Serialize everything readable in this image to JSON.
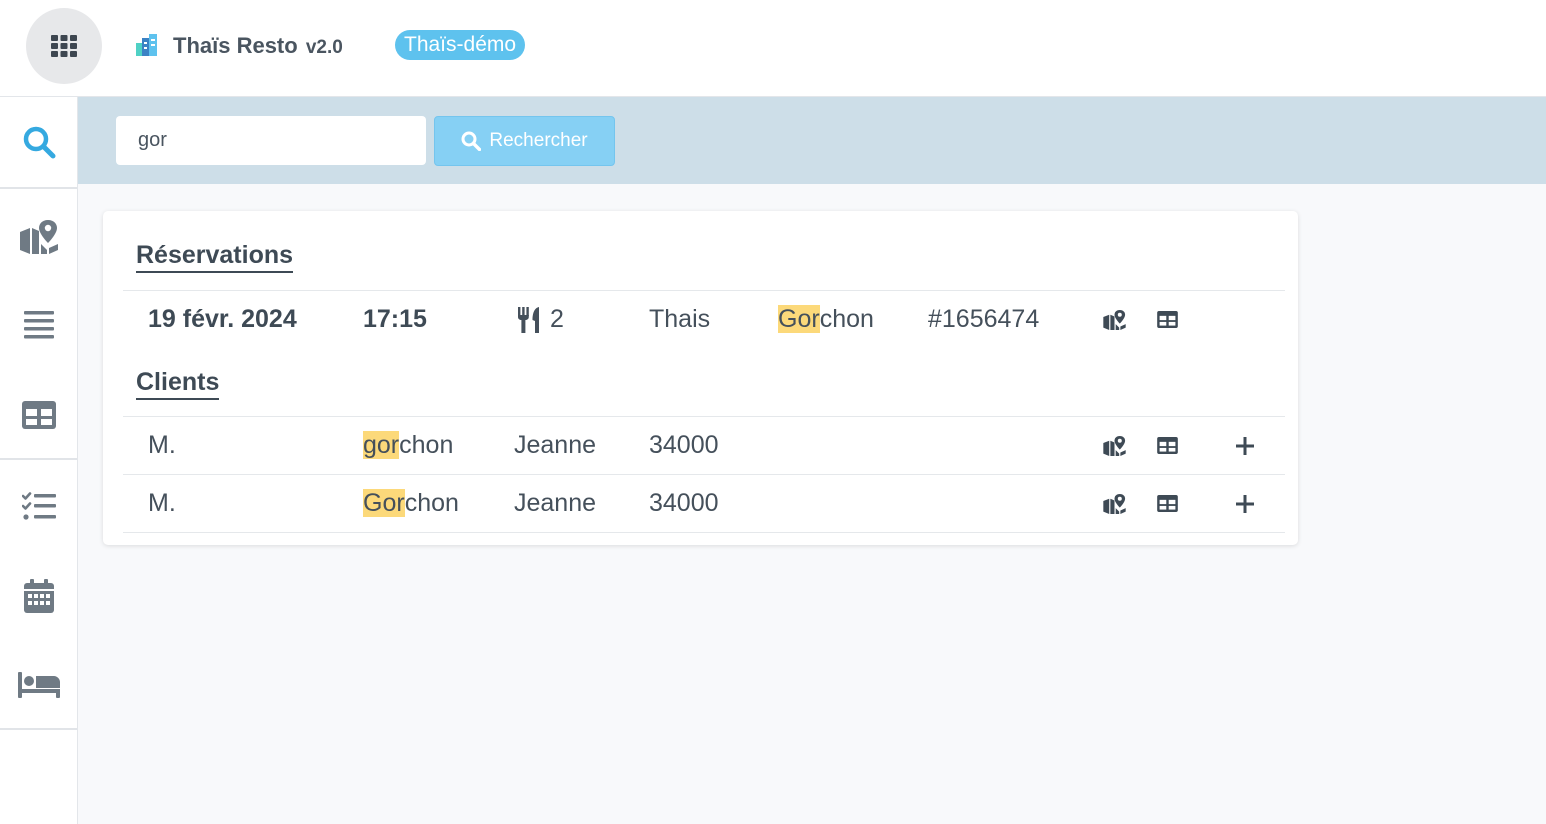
{
  "app": {
    "name": "Thaïs Resto",
    "version": "v2.0",
    "environment": "Thaïs-démo"
  },
  "sidebar": {
    "items": [
      {
        "name": "search",
        "icon": "search-icon",
        "active": true
      },
      {
        "name": "map",
        "icon": "map-icon"
      },
      {
        "name": "list",
        "icon": "list-icon"
      },
      {
        "name": "tables",
        "icon": "table-icon"
      },
      {
        "name": "tasks",
        "icon": "checklist-icon"
      },
      {
        "name": "calendar",
        "icon": "calendar-icon"
      },
      {
        "name": "hotel",
        "icon": "bed-icon"
      }
    ]
  },
  "search": {
    "value": "gor",
    "button_label": "Rechercher"
  },
  "results": {
    "reservations_title": "Réservations",
    "reservations": [
      {
        "date": "19 févr. 2024",
        "time": "17:15",
        "covers": "2",
        "first_name": "Thais",
        "last_name_match": "Gor",
        "last_name_rest": "chon",
        "reference": "#1656474"
      }
    ],
    "clients_title": "Clients",
    "clients": [
      {
        "civility": "M.",
        "last_name_match": "gor",
        "last_name_rest": "chon",
        "first_name": "Jeanne",
        "postcode": "34000"
      },
      {
        "civility": "M.",
        "last_name_match": "Gor",
        "last_name_rest": "chon",
        "first_name": "Jeanne",
        "postcode": "34000"
      }
    ]
  },
  "colors": {
    "accent": "#5ec2ee",
    "search_button": "#86d0f4",
    "search_band": "#cddee8",
    "highlight": "#fcd97a",
    "active_icon": "#35a9e0",
    "sidebar_icon": "#6f7a84"
  }
}
